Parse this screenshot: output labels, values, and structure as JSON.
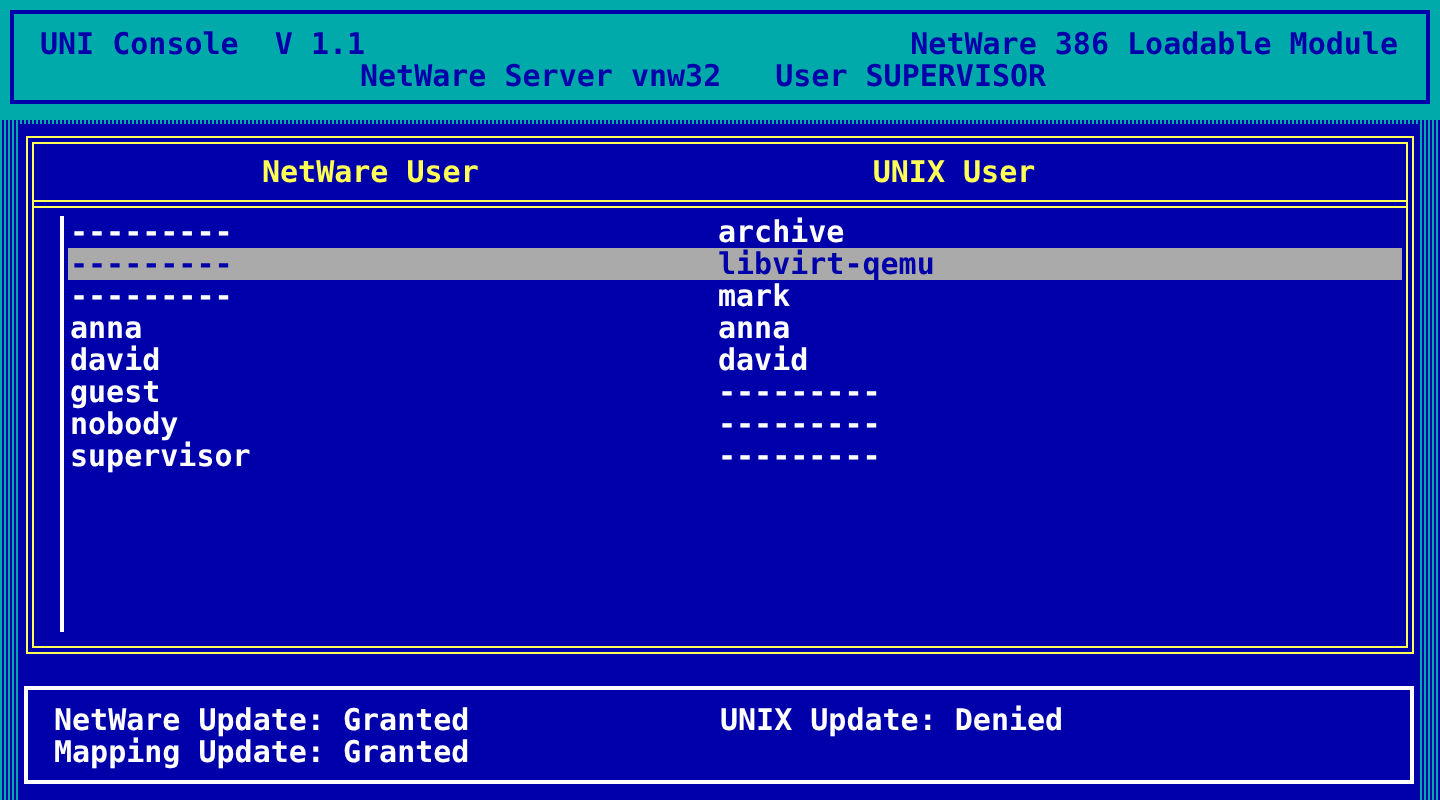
{
  "header": {
    "title": "UNI Console  V 1.1",
    "module": "NetWare 386 Loadable Module",
    "server": "NetWare Server vnw32",
    "user": "User SUPERVISOR"
  },
  "table": {
    "columns": [
      "NetWare User",
      "UNIX User"
    ],
    "rows": [
      {
        "netware_user": "---------",
        "unix_user": "archive",
        "selected": false
      },
      {
        "netware_user": "---------",
        "unix_user": "libvirt-qemu",
        "selected": true
      },
      {
        "netware_user": "---------",
        "unix_user": "mark",
        "selected": false
      },
      {
        "netware_user": "anna",
        "unix_user": "anna",
        "selected": false
      },
      {
        "netware_user": "david",
        "unix_user": "david",
        "selected": false
      },
      {
        "netware_user": "guest",
        "unix_user": "---------",
        "selected": false
      },
      {
        "netware_user": "nobody",
        "unix_user": "---------",
        "selected": false
      },
      {
        "netware_user": "supervisor",
        "unix_user": "---------",
        "selected": false
      }
    ]
  },
  "status": [
    [
      "NetWare Update: Granted",
      "UNIX Update: Denied"
    ],
    [
      "Mapping Update: Granted"
    ]
  ]
}
